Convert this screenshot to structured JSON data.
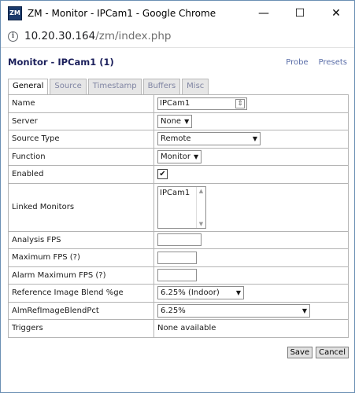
{
  "window": {
    "app_icon": "ZM",
    "title": "ZM - Monitor - IPCam1 - Google Chrome",
    "controls": {
      "minimize": "—",
      "maximize": "☐",
      "close": "✕"
    }
  },
  "address_bar": {
    "host": "10.20.30.164",
    "path": "/zm/index.php"
  },
  "monitor": {
    "title": "Monitor - IPCam1 (1)",
    "links": {
      "probe": "Probe",
      "presets": "Presets"
    },
    "tabs": [
      "General",
      "Source",
      "Timestamp",
      "Buffers",
      "Misc"
    ],
    "active_tab": "General"
  },
  "form": {
    "name": {
      "label": "Name",
      "value": "IPCam1"
    },
    "server": {
      "label": "Server",
      "value": "None"
    },
    "source_type": {
      "label": "Source Type",
      "value": "Remote"
    },
    "function": {
      "label": "Function",
      "value": "Monitor"
    },
    "enabled": {
      "label": "Enabled",
      "checked": true,
      "mark": "✔"
    },
    "linked_monitors": {
      "label": "Linked Monitors",
      "options": [
        "IPCam1"
      ]
    },
    "analysis_fps": {
      "label": "Analysis FPS",
      "value": ""
    },
    "maximum_fps": {
      "label": "Maximum FPS (?)",
      "value": ""
    },
    "alarm_maximum_fps": {
      "label": "Alarm Maximum FPS (?)",
      "value": ""
    },
    "ref_blend": {
      "label": "Reference Image Blend %ge",
      "value": "6.25% (Indoor)"
    },
    "alm_ref_blend": {
      "label": "AlmRefImageBlendPct",
      "value": "6.25%"
    },
    "triggers": {
      "label": "Triggers",
      "value": "None available"
    }
  },
  "buttons": {
    "save": "Save",
    "cancel": "Cancel"
  }
}
